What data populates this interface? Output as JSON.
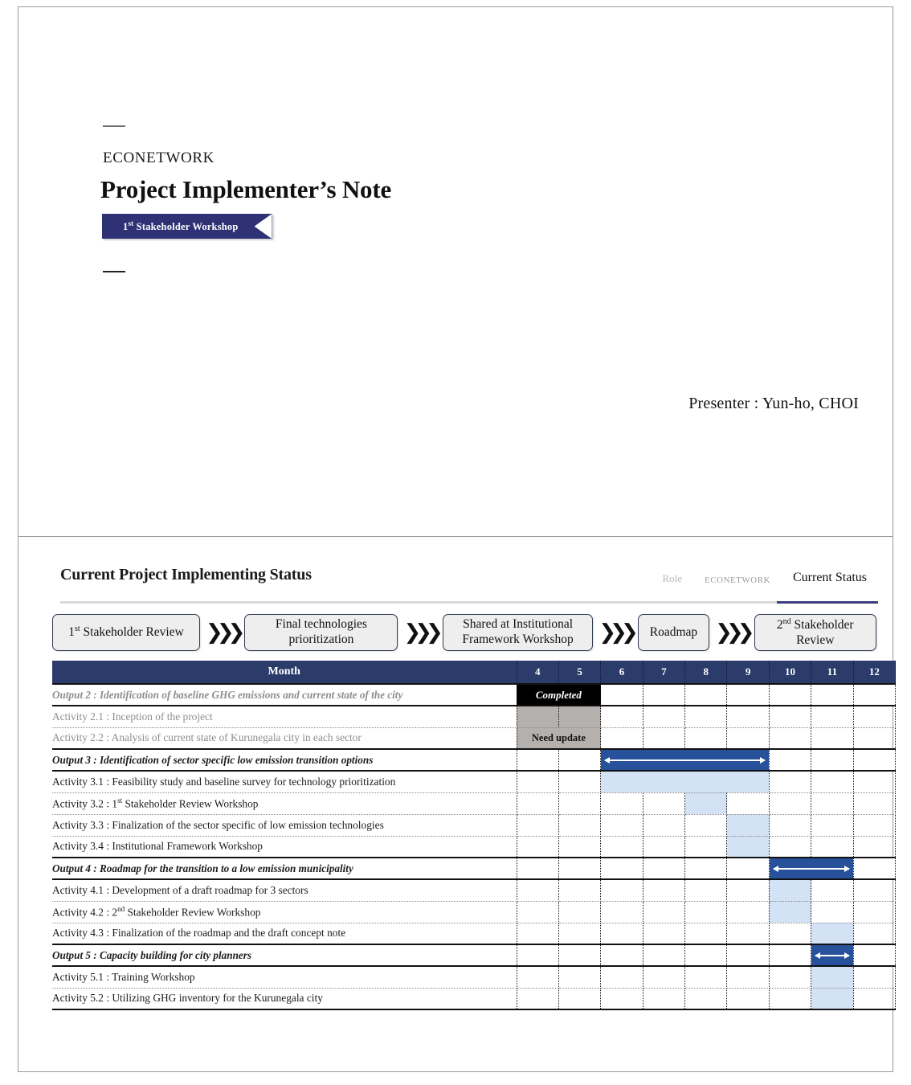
{
  "slide1": {
    "brand": "ECONETWORK",
    "title": "Project Implementer’s Note",
    "ribbon_prefix": "1",
    "ribbon_sup": "st",
    "ribbon_text": " Stakeholder Workshop",
    "presenter": "Presenter : Yun-ho, CHOI"
  },
  "slide2": {
    "title": "Current Project Implementing Status",
    "breadcrumbs": [
      {
        "label": "Role",
        "state": "inactive"
      },
      {
        "label": "ECONETWORK",
        "state": "faint"
      },
      {
        "label": "Current Status",
        "state": "active"
      }
    ],
    "flow": [
      {
        "line1": "1",
        "sup": "st",
        "line1b": " Stakeholder Review",
        "line2": ""
      },
      {
        "line1": "Final technologies",
        "line2": "prioritization"
      },
      {
        "line1": "Shared at Institutional",
        "line2": "Framework Workshop"
      },
      {
        "line1": "Roadmap",
        "line2": ""
      },
      {
        "line1": "2",
        "sup": "nd",
        "line1b": " Stakeholder",
        "line2": "Review"
      }
    ],
    "chevron": "»›",
    "table": {
      "month_header": "Month",
      "months": [
        "4",
        "5",
        "6",
        "7",
        "8",
        "9",
        "10",
        "11",
        "12"
      ],
      "rows": [
        {
          "kind": "output",
          "dim": true,
          "label": "Output 2 : Identification of baseline GHG emissions and current state of the city",
          "cells": [
            {
              "m": 0,
              "type": "black",
              "text": "Completed",
              "span": 2
            }
          ]
        },
        {
          "kind": "activity",
          "dim": true,
          "label": "Activity 2.1 : Inception of the project",
          "cells": [
            {
              "m": 0,
              "type": "grey",
              "text": "",
              "span": 1
            },
            {
              "m": 1,
              "type": "grey",
              "text": "",
              "span": 1
            }
          ]
        },
        {
          "kind": "activity",
          "dim": true,
          "label": "Activity 2.2 : Analysis of current state of Kurunegala city in each sector",
          "cells": [
            {
              "m": 0,
              "type": "grey",
              "text": "Need update",
              "span": 2
            }
          ]
        },
        {
          "kind": "output",
          "dim": false,
          "label": "Output 3 : Identification of sector specific low emission transition options",
          "cells": [
            {
              "m": 2,
              "type": "bar",
              "text": "",
              "span": 4
            }
          ]
        },
        {
          "kind": "activity",
          "dim": false,
          "label": "Activity 3.1 : Feasibility study and baseline survey for technology prioritization",
          "cells": [
            {
              "m": 2,
              "type": "light",
              "text": "",
              "span": 4
            }
          ]
        },
        {
          "kind": "activity",
          "dim": false,
          "label": "Activity 3.2 : 1|st| Stakeholder Review Workshop",
          "cells": [
            {
              "m": 4,
              "type": "light",
              "text": "",
              "span": 1
            }
          ]
        },
        {
          "kind": "activity",
          "dim": false,
          "label": "Activity 3.3 : Finalization of the sector specific of low emission technologies",
          "cells": [
            {
              "m": 5,
              "type": "light",
              "text": "",
              "span": 1
            }
          ]
        },
        {
          "kind": "activity",
          "dim": false,
          "label": "Activity 3.4 : Institutional Framework Workshop",
          "cells": [
            {
              "m": 5,
              "type": "light",
              "text": "",
              "span": 1
            }
          ]
        },
        {
          "kind": "output",
          "dim": false,
          "label": "Output 4 : Roadmap for the transition to a low emission municipality",
          "cells": [
            {
              "m": 6,
              "type": "bar",
              "text": "",
              "span": 2
            }
          ]
        },
        {
          "kind": "activity",
          "dim": false,
          "label": "Activity 4.1 : Development of a draft roadmap for 3 sectors",
          "cells": [
            {
              "m": 6,
              "type": "light",
              "text": "",
              "span": 1
            }
          ]
        },
        {
          "kind": "activity",
          "dim": false,
          "label": "Activity 4.2 : 2|nd| Stakeholder Review Workshop",
          "cells": [
            {
              "m": 6,
              "type": "light",
              "text": "",
              "span": 1
            }
          ]
        },
        {
          "kind": "activity",
          "dim": false,
          "label": "Activity 4.3 : Finalization of the roadmap and the draft concept note",
          "cells": [
            {
              "m": 7,
              "type": "light",
              "text": "",
              "span": 1
            }
          ]
        },
        {
          "kind": "output",
          "dim": false,
          "label": "Output 5 : Capacity building for city planners",
          "cells": [
            {
              "m": 7,
              "type": "bar",
              "text": "",
              "span": 1
            }
          ]
        },
        {
          "kind": "activity",
          "dim": false,
          "label": "Activity 5.1 : Training Workshop",
          "cells": [
            {
              "m": 7,
              "type": "light",
              "text": "",
              "span": 1
            }
          ]
        },
        {
          "kind": "activity",
          "dim": false,
          "last": true,
          "label": "Activity 5.2 : Utilizing GHG inventory for the Kurunegala city",
          "cells": [
            {
              "m": 7,
              "type": "light",
              "text": "",
              "span": 1
            }
          ]
        }
      ]
    }
  },
  "colors": {
    "navy": "#2e3275",
    "table_header": "#2b3c6b",
    "bar": "#28519b",
    "light_bar": "#d3e2f5",
    "grey_cell": "#b4b0ae",
    "black_cell": "#000000"
  }
}
